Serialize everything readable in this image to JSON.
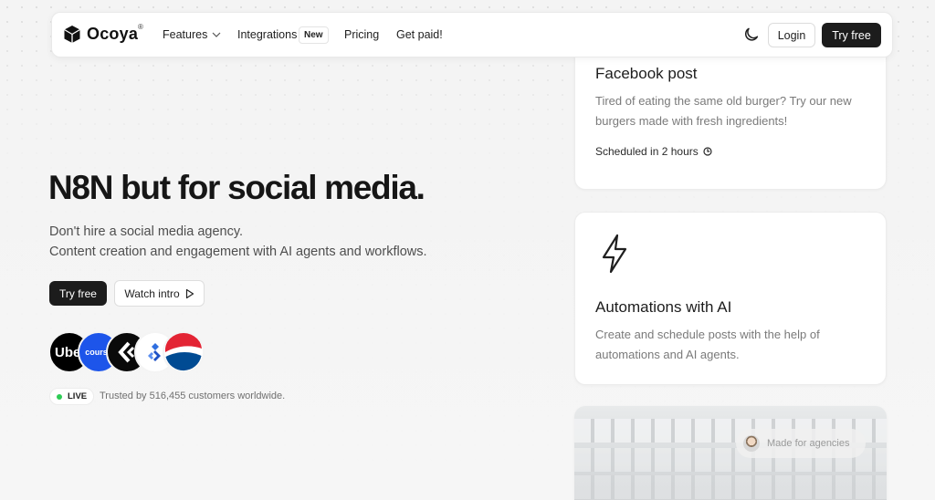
{
  "nav": {
    "brand": "Ocoya",
    "brand_mark": "®",
    "items": [
      {
        "label": "Features"
      },
      {
        "label": "Integrations",
        "badge": "New"
      },
      {
        "label": "Pricing"
      },
      {
        "label": "Get paid!"
      }
    ],
    "login_label": "Login",
    "try_label": "Try free",
    "theme_icon": "moon-icon"
  },
  "hero": {
    "title": "N8N but for social media.",
    "subtitle_1": "Don't hire a social media agency.",
    "subtitle_2": "Content creation and engagement with AI agents and workflows.",
    "cta_primary": "Try free",
    "cta_secondary": "Watch intro",
    "customer_logos": [
      {
        "name": "uber-logo",
        "text": "Ube"
      },
      {
        "name": "coursera-logo",
        "text": "course"
      },
      {
        "name": "craft-logo"
      },
      {
        "name": "jira-logo"
      },
      {
        "name": "pepsi-logo"
      }
    ],
    "live_label": "LIVE",
    "trusted_text": "Trusted by 516,455 customers worldwide."
  },
  "cards": {
    "facebook": {
      "title": "Facebook post",
      "text": "Tired of eating the same old burger? Try our new burgers made with fresh ingredients!",
      "scheduled": "Scheduled in 2 hours"
    },
    "automations": {
      "title": "Automations with AI",
      "text": "Create and schedule posts with the help of automations and AI agents."
    },
    "agencies": {
      "label": "Made for agencies"
    }
  },
  "colors": {
    "primary_dark": "#1c1c1c",
    "live_green": "#2ecc55",
    "coursera_blue": "#1d55ea",
    "pepsi_red": "#e32434",
    "pepsi_blue": "#004b93"
  }
}
